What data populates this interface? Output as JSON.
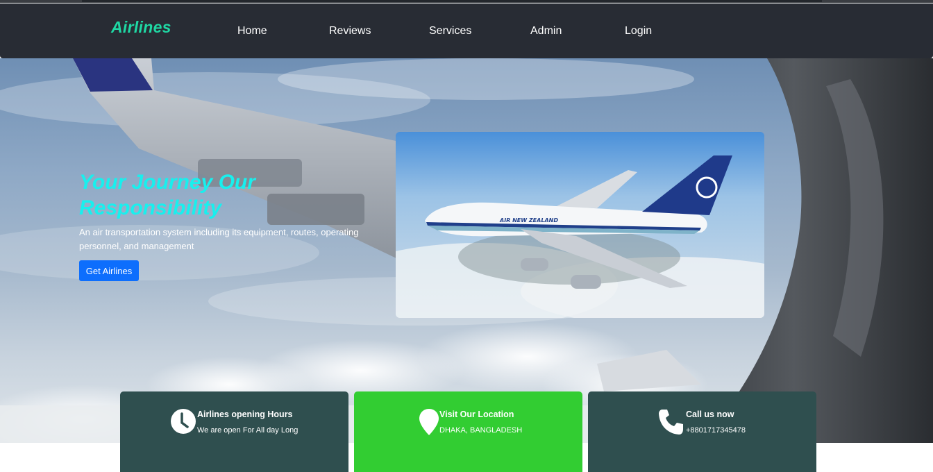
{
  "brand": {
    "name": "Airlines"
  },
  "nav": {
    "items": [
      "Home",
      "Reviews",
      "Services",
      "Admin",
      "Login"
    ]
  },
  "hero": {
    "title": "Your Journey Our Responsibility",
    "description": "An air transportation system including its equipment, routes, operating personnel, and management",
    "button_label": "Get Airlines",
    "aircraft_livery": "AIR NEW ZEALAND"
  },
  "info_cards": [
    {
      "icon": "clock-icon",
      "title": "Airlines opening Hours",
      "subtitle": "We are open For All day Long"
    },
    {
      "icon": "location-pin-icon",
      "title": "Visit Our Location",
      "subtitle": "DHAKA, BANGLADESH"
    },
    {
      "icon": "phone-icon",
      "title": "Call us now",
      "subtitle": "+8801717345478"
    }
  ],
  "colors": {
    "navbar_bg": "#282c34",
    "brand": "#1fd8a4",
    "hero_title": "#18f0ee",
    "primary_button": "#0d6efd",
    "card_dark": "#2f4f4f",
    "card_green": "#32cd32"
  }
}
